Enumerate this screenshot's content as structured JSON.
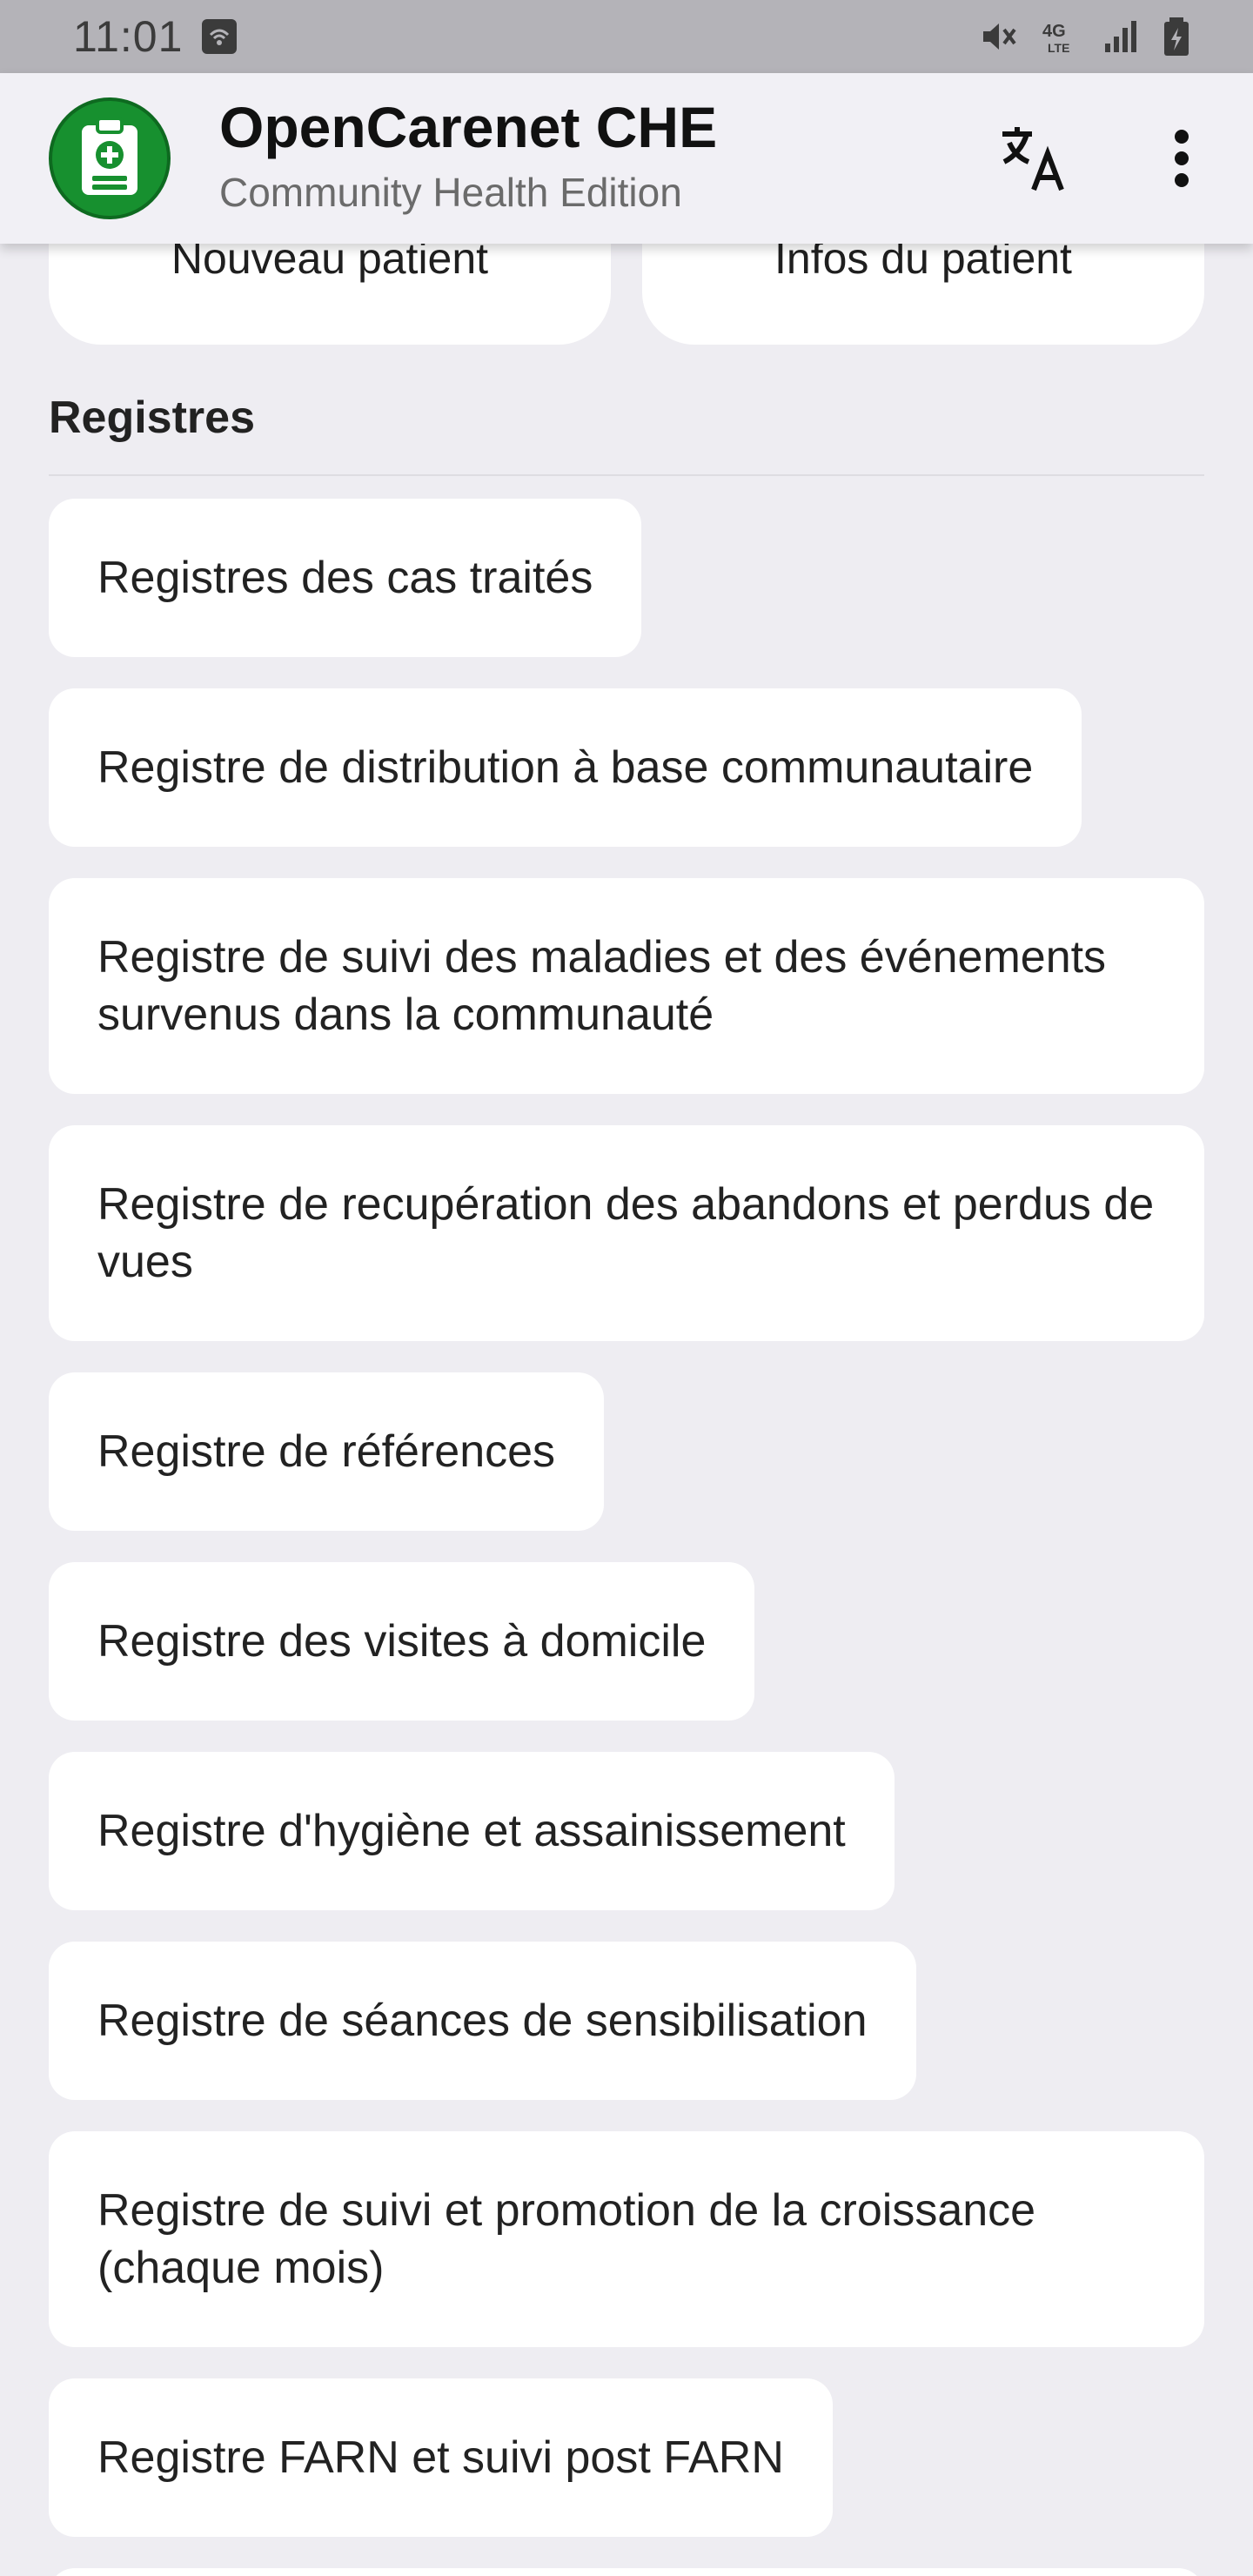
{
  "status_bar": {
    "time": "11:01"
  },
  "app_bar": {
    "title": "OpenCarenet CHE",
    "subtitle": "Community Health Edition",
    "logo_color": "#17902f"
  },
  "top_cards": [
    {
      "label": "Nouveau patient"
    },
    {
      "label": "Infos du patient"
    }
  ],
  "registres": {
    "title": "Registres",
    "items": [
      {
        "label": "Registres des cas traités"
      },
      {
        "label": "Registre de distribution à base communautaire"
      },
      {
        "label": "Registre de suivi des maladies et des événements survenus dans la communauté"
      },
      {
        "label": "Registre de recupération des abandons et perdus de vues"
      },
      {
        "label": "Registre de références"
      },
      {
        "label": "Registre des visites à domicile"
      },
      {
        "label": "Registre d'hygiène et assainissement"
      },
      {
        "label": "Registre de séances de sensibilisation"
      },
      {
        "label": "Registre de suivi et promotion de la croissance (chaque mois)"
      },
      {
        "label": "Registre FARN et suivi post FARN"
      }
    ]
  },
  "icons": {
    "translate": "translate-icon",
    "more": "more-vert-icon",
    "logo": "clipboard-medical-icon"
  }
}
